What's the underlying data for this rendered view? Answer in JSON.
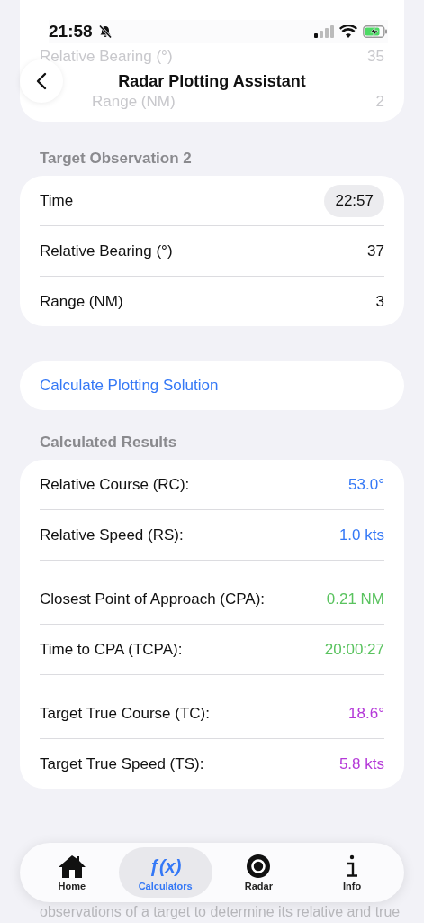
{
  "status_bar": {
    "time": "21:58",
    "silent": true
  },
  "previous_card": {
    "rows": [
      {
        "label": "Relative Bearing (°)",
        "value": "35"
      },
      {
        "label": "Range (NM)",
        "value": "2"
      }
    ]
  },
  "header": {
    "title": "Radar Plotting Assistant"
  },
  "observation": {
    "heading": "Target Observation 2",
    "rows": [
      {
        "kind": "time",
        "label": "Time",
        "value": "22:57"
      },
      {
        "kind": "number",
        "label": "Relative Bearing (°)",
        "value": "37"
      },
      {
        "kind": "number",
        "label": "Range (NM)",
        "value": "3"
      }
    ]
  },
  "calculate_button": "Calculate Plotting Solution",
  "results": {
    "heading": "Calculated Results",
    "groups": [
      [
        {
          "label": "Relative Course (RC):",
          "value": "53.0°",
          "color": "#3478f6"
        },
        {
          "label": "Relative Speed (RS):",
          "value": "1.0 kts",
          "color": "#3478f6"
        }
      ],
      [
        {
          "label": "Closest Point of Approach (CPA):",
          "value": "0.21 NM",
          "color": "#5ac35f"
        },
        {
          "label": "Time to CPA (TCPA):",
          "value": "20:00:27",
          "color": "#5ac35f"
        }
      ],
      [
        {
          "label": "Target True Course (TC):",
          "value": "18.6°",
          "color": "#b438d8"
        },
        {
          "label": "Target True Speed (TS):",
          "value": "5.8 kts",
          "color": "#b438d8"
        }
      ]
    ]
  },
  "explanation": {
    "text": "observations of a target to determine its relative and true"
  },
  "tab_bar": [
    {
      "kind": "house",
      "label": "Home",
      "selected": false
    },
    {
      "kind": "glyph",
      "glyph": "ƒ(x)",
      "label": "Calculators",
      "selected": true
    },
    {
      "kind": "target",
      "label": "Radar",
      "selected": false
    },
    {
      "kind": "info",
      "label": "Info",
      "selected": false
    }
  ]
}
